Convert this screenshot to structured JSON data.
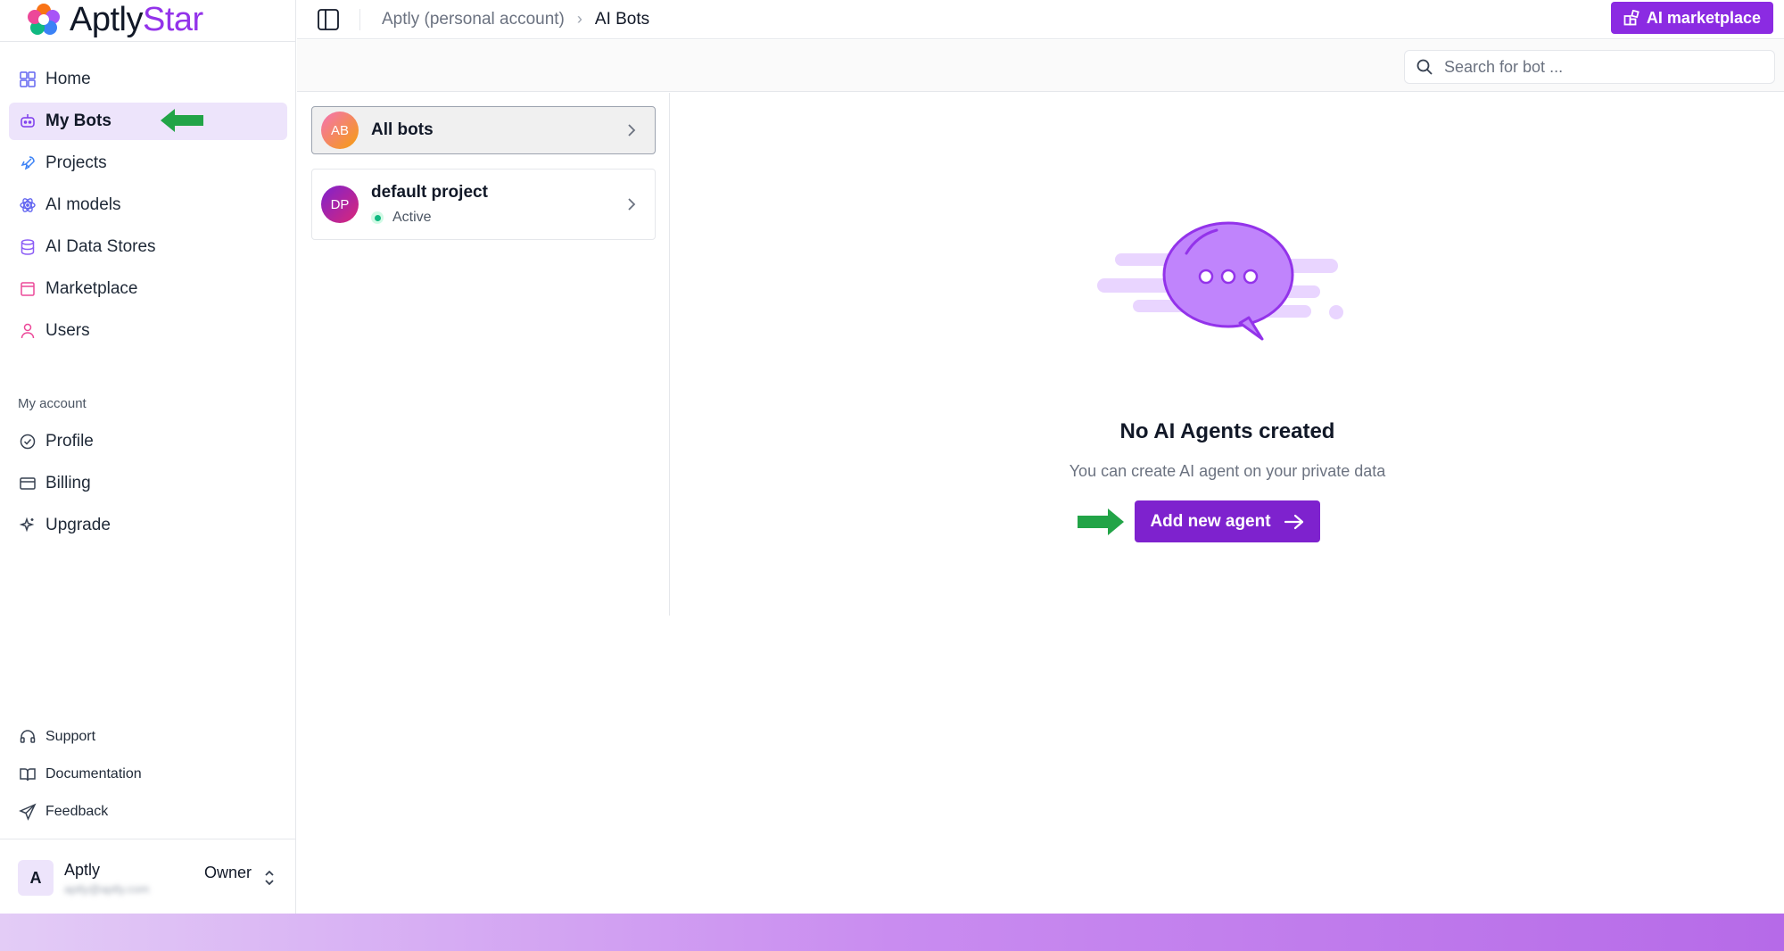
{
  "brand": {
    "name_main": "Aptly",
    "name_accent": "Star"
  },
  "sidebar": {
    "items": [
      {
        "label": "Home",
        "icon": "grid-icon"
      },
      {
        "label": "My Bots",
        "icon": "bot-icon",
        "active": true
      },
      {
        "label": "Projects",
        "icon": "rocket-icon"
      },
      {
        "label": "AI models",
        "icon": "atom-icon"
      },
      {
        "label": "AI Data Stores",
        "icon": "database-icon"
      },
      {
        "label": "Marketplace",
        "icon": "store-icon"
      },
      {
        "label": "Users",
        "icon": "user-icon"
      }
    ],
    "section_label": "My account",
    "account_items": [
      {
        "label": "Profile",
        "icon": "check-circle-icon"
      },
      {
        "label": "Billing",
        "icon": "credit-card-icon"
      },
      {
        "label": "Upgrade",
        "icon": "sparkles-icon"
      }
    ],
    "bottom_items": [
      {
        "label": "Support",
        "icon": "headset-icon"
      },
      {
        "label": "Documentation",
        "icon": "book-icon"
      },
      {
        "label": "Feedback",
        "icon": "send-icon"
      }
    ],
    "user": {
      "initial": "A",
      "name": "Aptly",
      "email": "aptly@aptly.com",
      "role": "Owner"
    }
  },
  "header": {
    "breadcrumb": [
      "Aptly (personal account)",
      "AI Bots"
    ],
    "marketplace_label": "AI marketplace"
  },
  "search": {
    "placeholder": "Search for bot ...",
    "value": ""
  },
  "projects": [
    {
      "initials": "AB",
      "name": "All bots",
      "selected": true
    },
    {
      "initials": "DP",
      "name": "default project",
      "status": "Active"
    }
  ],
  "empty_state": {
    "title": "No AI Agents created",
    "subtitle": "You can create AI agent on your private data",
    "button_label": "Add new agent"
  },
  "colors": {
    "accent": "#7e22ce",
    "accent_light": "#ede4fb",
    "annotation_arrow": "#16a34a"
  }
}
